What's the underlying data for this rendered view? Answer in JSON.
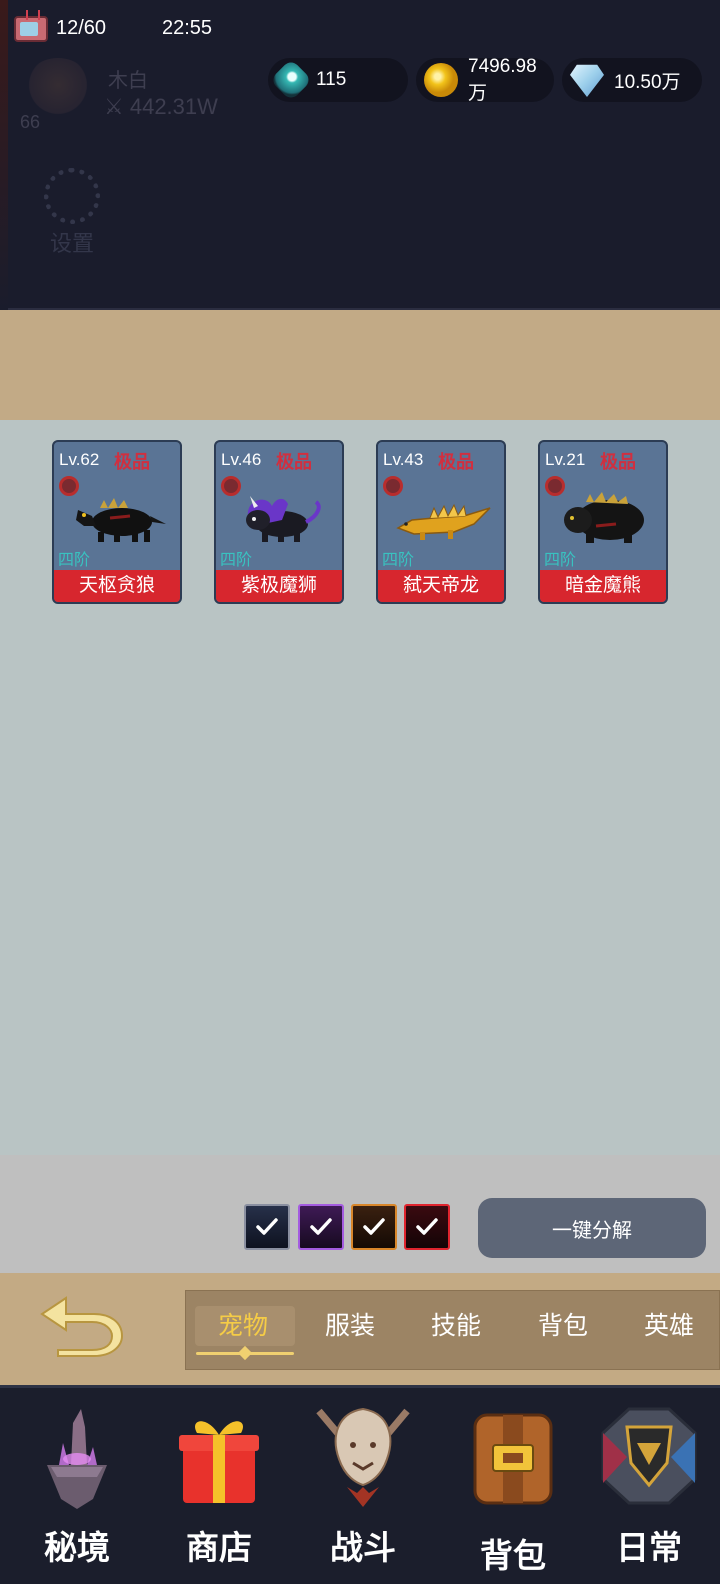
{
  "status": {
    "energy": "12/60",
    "time": "22:55"
  },
  "player": {
    "name": "木白",
    "power": "442.31W",
    "level": "66",
    "settings_label": "设置"
  },
  "currency": {
    "gem": "115",
    "gold": "7496.98万",
    "diamond": "10.50万"
  },
  "pets": [
    {
      "level": "Lv.62",
      "quality": "极品",
      "tier": "四阶",
      "name": "天枢贪狼",
      "sprite": "black-wolf"
    },
    {
      "level": "Lv.46",
      "quality": "极品",
      "tier": "四阶",
      "name": "紫极魔狮",
      "sprite": "purple-lion"
    },
    {
      "level": "Lv.43",
      "quality": "极品",
      "tier": "四阶",
      "name": "弑天帝龙",
      "sprite": "gold-dragon"
    },
    {
      "level": "Lv.21",
      "quality": "极品",
      "tier": "四阶",
      "name": "暗金魔熊",
      "sprite": "dark-bear"
    }
  ],
  "filters": [
    {
      "rarity": "common",
      "checked": true
    },
    {
      "rarity": "epic",
      "checked": true
    },
    {
      "rarity": "legendary",
      "checked": true
    },
    {
      "rarity": "mythic",
      "checked": true
    }
  ],
  "decompose_label": "一键分解",
  "tabs": [
    {
      "label": "宠物",
      "active": true
    },
    {
      "label": "服装",
      "active": false
    },
    {
      "label": "技能",
      "active": false
    },
    {
      "label": "背包",
      "active": false
    },
    {
      "label": "英雄",
      "active": false
    }
  ],
  "nav": [
    {
      "label": "秘境",
      "icon": "crystal-island-icon"
    },
    {
      "label": "商店",
      "icon": "gift-box-icon"
    },
    {
      "label": "战斗",
      "icon": "lion-crest-icon"
    },
    {
      "label": "背包",
      "icon": "backpack-icon"
    },
    {
      "label": "日常",
      "icon": "shield-emblem-icon"
    }
  ],
  "colors": {
    "quality_red": "#d12f3f",
    "tier_cyan": "#39c2c0",
    "tab_active": "#f5cc46"
  }
}
